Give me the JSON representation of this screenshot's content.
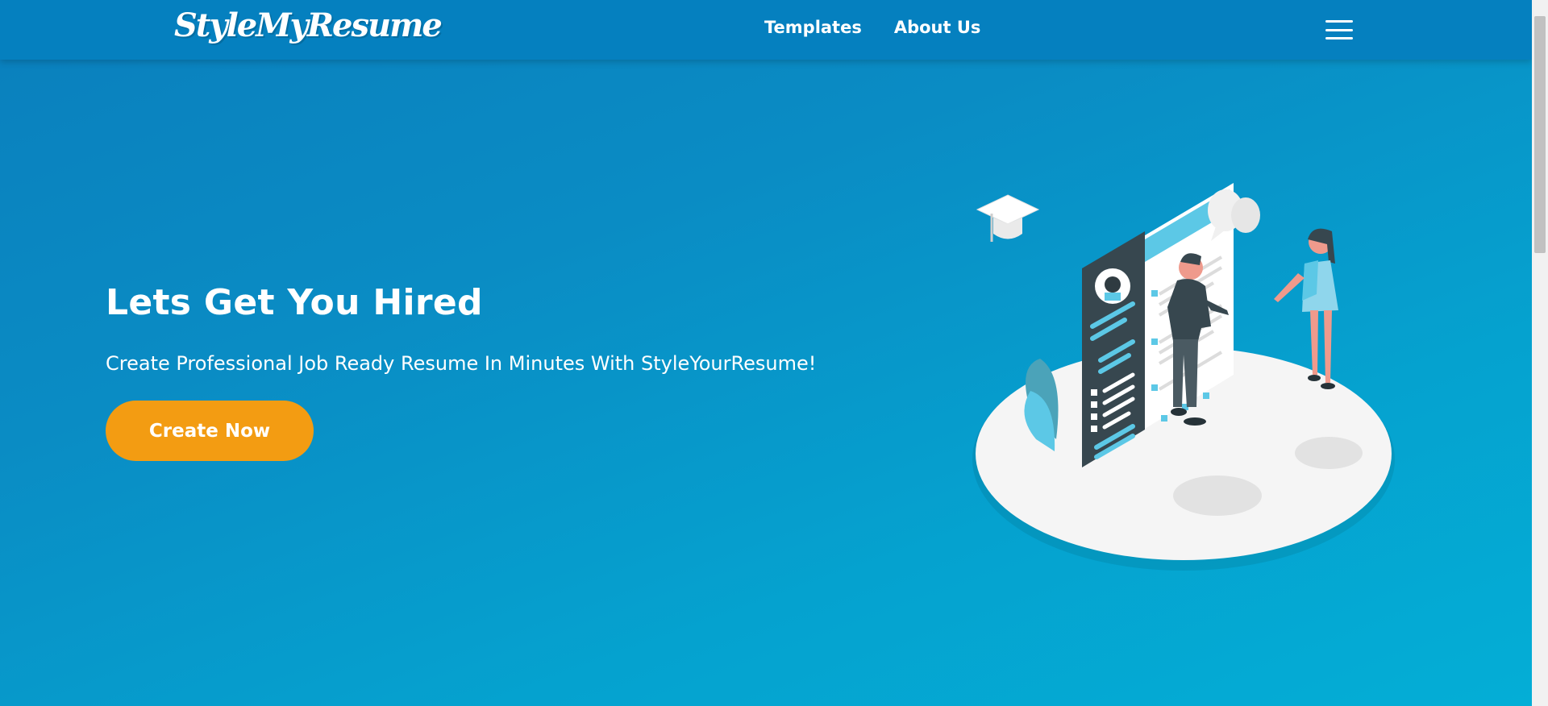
{
  "nav": {
    "logo": "StyleMyResume",
    "links": [
      "Templates",
      "About Us"
    ],
    "menu_icon": "hamburger-menu-icon"
  },
  "hero": {
    "title": "Lets Get You Hired",
    "subtitle": "Create Professional Job Ready Resume In Minutes With StyleYourResume!",
    "cta_label": "Create Now"
  },
  "illustration": {
    "description_icon": "resume-handshake-illustration"
  },
  "colors": {
    "nav_bg": "#0580bf",
    "hero_bg_start": "#0a7fbd",
    "hero_bg_end": "#04aed6",
    "cta_bg": "#f39c12",
    "text": "#ffffff"
  }
}
